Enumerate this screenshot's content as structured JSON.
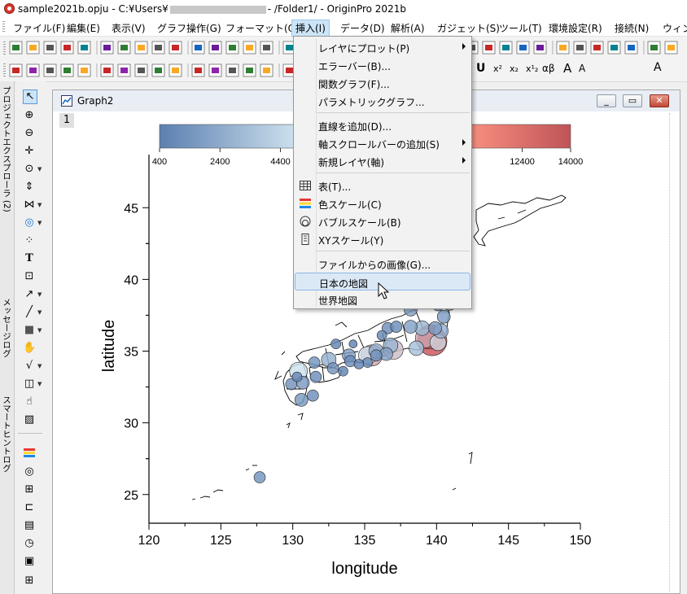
{
  "window": {
    "title_prefix": "sample2021b.opju - C:¥Users¥",
    "title_suffix": "- /Folder1/ - OriginPro 2021b"
  },
  "menubar": [
    "ファイル(F)",
    "編集(E)",
    "表示(V)",
    "グラフ操作(G)",
    "フォーマット(O)",
    "挿入(I)",
    "データ(D)",
    "解析(A)",
    "ガジェット(S)",
    "ツール(T)",
    "環境設定(R)",
    "接続(N)",
    "ウィンド"
  ],
  "active_menu": "挿入(I)",
  "side_tabs": [
    "プロジェクトエクスプローラ (2)",
    "メッセージログ",
    "スマートヒントログ"
  ],
  "graph_window": {
    "title": "Graph2",
    "layer": "1"
  },
  "insert_menu": {
    "items": [
      {
        "label": "レイヤにプロット(P)",
        "submenu": true
      },
      {
        "label": "エラーバー(B)..."
      },
      {
        "label": "関数グラフ(F)..."
      },
      {
        "label": "パラメトリックグラフ..."
      },
      {
        "sep": true
      },
      {
        "label": "直線を追加(D)..."
      },
      {
        "label": "軸スクロールバーの追加(S)",
        "submenu": true
      },
      {
        "label": "新規レイヤ(軸)",
        "submenu": true
      },
      {
        "sep": true
      },
      {
        "label": "表(T)...",
        "icon": "table-icon"
      },
      {
        "label": "色スケール(C)",
        "icon": "color-scale-icon"
      },
      {
        "label": "バブルスケール(B)",
        "icon": "bubble-scale-icon"
      },
      {
        "label": "XYスケール(Y)",
        "icon": "xy-scale-icon"
      },
      {
        "sep": true
      },
      {
        "label": "ファイルからの画像(G)..."
      },
      {
        "label": "日本の地図",
        "highlighted": true
      },
      {
        "label": "世界地図"
      }
    ]
  },
  "colorbar": {
    "tick_labels": [
      "400",
      "2400",
      "4400",
      "12400",
      "14000"
    ]
  },
  "chart_data": {
    "type": "scatter",
    "xlabel": "longitude",
    "ylabel": "latitude",
    "xlim": [
      120,
      150
    ],
    "ylim": [
      23,
      47
    ],
    "xticks": [
      "120",
      "125",
      "130",
      "135",
      "140",
      "145",
      "150"
    ],
    "yticks": [
      "25",
      "30",
      "35",
      "40",
      "45"
    ],
    "colorscale": {
      "min": 400,
      "max": 14000,
      "low_color": "#5b7fb0",
      "mid_color": "#cfe3ef",
      "high_color": "#c9545a"
    },
    "points": [
      {
        "x": 139.7,
        "y": 35.7,
        "v": 14000,
        "s": 18
      },
      {
        "x": 139.6,
        "y": 36.0,
        "v": 13000,
        "s": 15
      },
      {
        "x": 139.2,
        "y": 35.9,
        "v": 9000,
        "s": 12
      },
      {
        "x": 139.0,
        "y": 36.6,
        "v": 3000,
        "s": 9
      },
      {
        "x": 140.1,
        "y": 35.6,
        "v": 6000,
        "s": 10
      },
      {
        "x": 138.6,
        "y": 35.2,
        "v": 3500,
        "s": 9
      },
      {
        "x": 137.0,
        "y": 35.1,
        "v": 7500,
        "s": 12
      },
      {
        "x": 136.8,
        "y": 35.4,
        "v": 3000,
        "s": 9
      },
      {
        "x": 136.5,
        "y": 34.8,
        "v": 2000,
        "s": 8
      },
      {
        "x": 135.5,
        "y": 34.7,
        "v": 8800,
        "s": 13
      },
      {
        "x": 135.2,
        "y": 34.7,
        "v": 5500,
        "s": 11
      },
      {
        "x": 135.8,
        "y": 35.0,
        "v": 2600,
        "s": 9
      },
      {
        "x": 135.8,
        "y": 34.7,
        "v": 1300,
        "s": 7
      },
      {
        "x": 135.2,
        "y": 34.2,
        "v": 900,
        "s": 6
      },
      {
        "x": 136.2,
        "y": 36.1,
        "v": 800,
        "s": 6
      },
      {
        "x": 136.6,
        "y": 36.6,
        "v": 1100,
        "s": 7
      },
      {
        "x": 137.2,
        "y": 36.7,
        "v": 1000,
        "s": 7
      },
      {
        "x": 138.2,
        "y": 36.7,
        "v": 2000,
        "s": 8
      },
      {
        "x": 138.2,
        "y": 37.9,
        "v": 2200,
        "s": 8
      },
      {
        "x": 139.9,
        "y": 36.6,
        "v": 1900,
        "s": 8
      },
      {
        "x": 140.3,
        "y": 36.4,
        "v": 2800,
        "s": 9
      },
      {
        "x": 140.5,
        "y": 37.4,
        "v": 1800,
        "s": 8
      },
      {
        "x": 140.9,
        "y": 38.3,
        "v": 2300,
        "s": 8
      },
      {
        "x": 140.1,
        "y": 38.2,
        "v": 1100,
        "s": 7
      },
      {
        "x": 140.1,
        "y": 39.7,
        "v": 1000,
        "s": 7
      },
      {
        "x": 141.2,
        "y": 39.7,
        "v": 1200,
        "s": 7
      },
      {
        "x": 140.7,
        "y": 40.8,
        "v": 1300,
        "s": 7
      },
      {
        "x": 134.2,
        "y": 35.5,
        "v": 600,
        "s": 5
      },
      {
        "x": 133.0,
        "y": 35.5,
        "v": 700,
        "s": 6
      },
      {
        "x": 133.9,
        "y": 34.7,
        "v": 1900,
        "s": 8
      },
      {
        "x": 132.5,
        "y": 34.4,
        "v": 2800,
        "s": 9
      },
      {
        "x": 131.5,
        "y": 34.2,
        "v": 1400,
        "s": 7
      },
      {
        "x": 134.6,
        "y": 34.1,
        "v": 700,
        "s": 6
      },
      {
        "x": 134.0,
        "y": 34.3,
        "v": 1000,
        "s": 7
      },
      {
        "x": 132.8,
        "y": 33.8,
        "v": 1400,
        "s": 7
      },
      {
        "x": 133.5,
        "y": 33.6,
        "v": 700,
        "s": 6
      },
      {
        "x": 130.4,
        "y": 33.6,
        "v": 5100,
        "s": 11
      },
      {
        "x": 130.3,
        "y": 33.2,
        "v": 800,
        "s": 6
      },
      {
        "x": 129.9,
        "y": 32.7,
        "v": 1300,
        "s": 7
      },
      {
        "x": 130.7,
        "y": 32.8,
        "v": 1700,
        "s": 8
      },
      {
        "x": 131.6,
        "y": 33.2,
        "v": 1100,
        "s": 7
      },
      {
        "x": 131.4,
        "y": 31.9,
        "v": 1100,
        "s": 7
      },
      {
        "x": 130.6,
        "y": 31.6,
        "v": 1600,
        "s": 8
      },
      {
        "x": 127.7,
        "y": 26.2,
        "v": 1400,
        "s": 7
      }
    ]
  }
}
